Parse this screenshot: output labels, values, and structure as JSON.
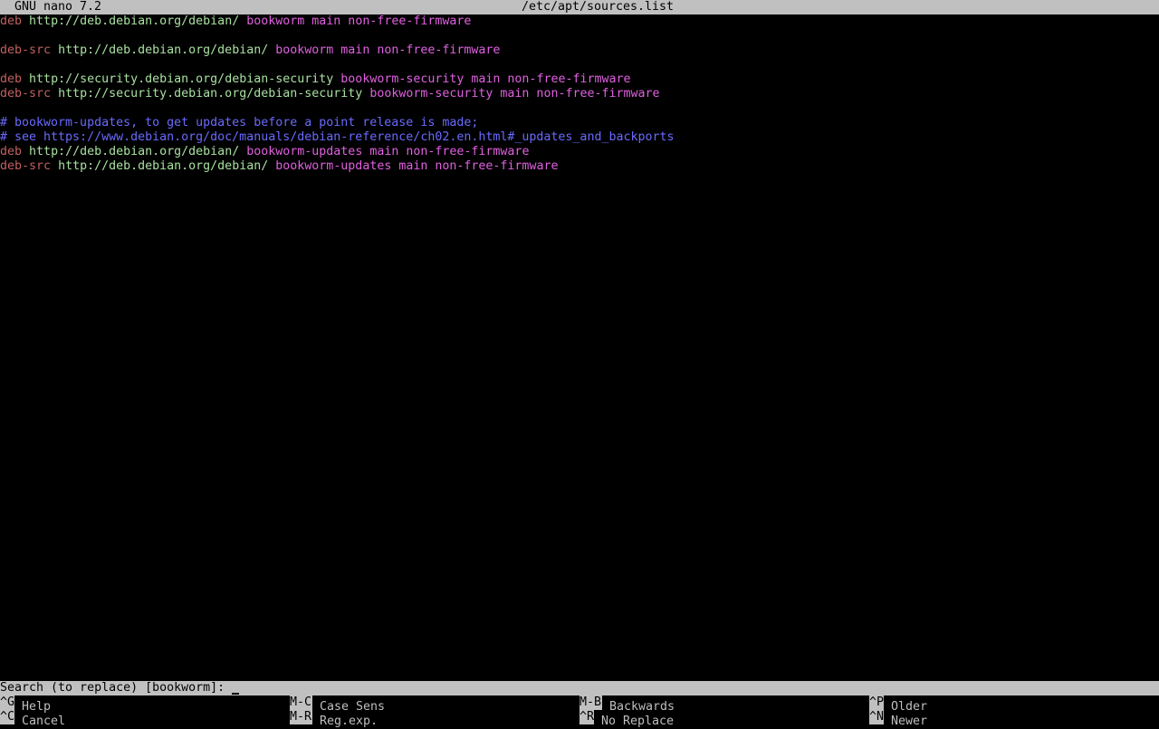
{
  "titlebar": {
    "app_version": "GNU nano 7.2",
    "filename": "/etc/apt/sources.list"
  },
  "lines": [
    {
      "kw": "deb",
      "url": "http://deb.debian.org/debian/",
      "dist": "bookworm main non-free-firmware"
    },
    {
      "kw": "",
      "url": "",
      "dist": ""
    },
    {
      "kw": "deb-src",
      "url": "http://deb.debian.org/debian/",
      "dist": "bookworm main non-free-firmware"
    },
    {
      "kw": "",
      "url": "",
      "dist": ""
    },
    {
      "kw": "deb",
      "url": "http://security.debian.org/debian-security",
      "dist": "bookworm-security main non-free-firmware"
    },
    {
      "kw": "deb-src",
      "url": "http://security.debian.org/debian-security",
      "dist": "bookworm-security main non-free-firmware"
    },
    {
      "kw": "",
      "url": "",
      "dist": ""
    },
    {
      "comment": "# bookworm-updates, to get updates before a point release is made;"
    },
    {
      "comment": "# see https://www.debian.org/doc/manuals/debian-reference/ch02.en.html#_updates_and_backports"
    },
    {
      "kw": "deb",
      "url": "http://deb.debian.org/debian/",
      "dist": "bookworm-updates main non-free-firmware"
    },
    {
      "kw": "deb-src",
      "url": "http://deb.debian.org/debian/",
      "dist": "bookworm-updates main non-free-firmware"
    }
  ],
  "prompt": {
    "text": "Search (to replace) [bookworm]: "
  },
  "shortcuts": {
    "help": {
      "key": "^G",
      "label": "Help"
    },
    "cancel": {
      "key": "^C",
      "label": "Cancel"
    },
    "case_sens": {
      "key": "M-C",
      "label": "Case Sens"
    },
    "regexp": {
      "key": "M-R",
      "label": "Reg.exp."
    },
    "backwards": {
      "key": "M-B",
      "label": "Backwards"
    },
    "no_replace": {
      "key": "^R",
      "label": "No Replace"
    },
    "older": {
      "key": "^P",
      "label": "Older"
    },
    "newer": {
      "key": "^N",
      "label": "Newer"
    }
  }
}
